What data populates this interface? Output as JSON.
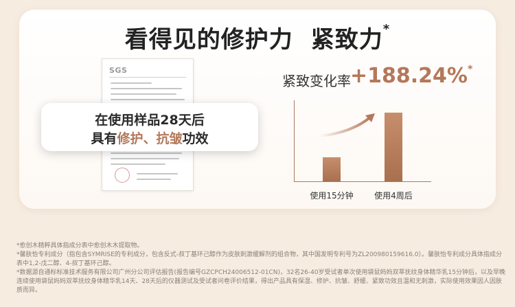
{
  "headline": {
    "part1": "看得见的修护力",
    "part2": "紧致力",
    "mark": "*"
  },
  "document": {
    "logo": "SGS"
  },
  "callout": {
    "line1": "在使用样品28天后",
    "line2_prefix": "具有",
    "accent1": "修护",
    "sep": "、",
    "accent2": "抗皱",
    "line2_suffix": "功效"
  },
  "metric": {
    "label": "紧致变化率",
    "value": "+188.24%",
    "mark": "*"
  },
  "chart_data": {
    "type": "bar",
    "categories": [
      "使用15分钟",
      "使用4周后"
    ],
    "values": [
      1,
      2.88
    ],
    "title": "",
    "xlabel": "",
    "ylabel": "",
    "accent_color": "#b4785a"
  },
  "footnotes": [
    "*愈创木精粹具体指成分表中愈创木木提取物。",
    "*馨肤怡专利成分（指包含SYMRISE的专利成分，包含反式-叔丁基环己醇作为皮肤刺激缓解剂的组合物，其中国发明专利号为ZL200980159616.0）。馨肤怡专利成分具体指成分表中1,2-戊二醇、4-叔丁基环己醇。",
    "*数据源自通标标准技术服务有限公司广州分公司评估报告(报告编号GZCPCH24006512-01CN)，32名26-40岁受试者单次使用袋鼠妈妈双萃抚纹身体精华乳15分钟后，以及早晚连续使用袋鼠妈妈双萃抚纹身体精华乳14天、28天后的仪器测试及受试者问卷评价结果，得出产品具有保湿、修护、抗皱、舒缓、紧致功效且温和无刺激，实际使用效果因人因肤质而异。"
  ]
}
